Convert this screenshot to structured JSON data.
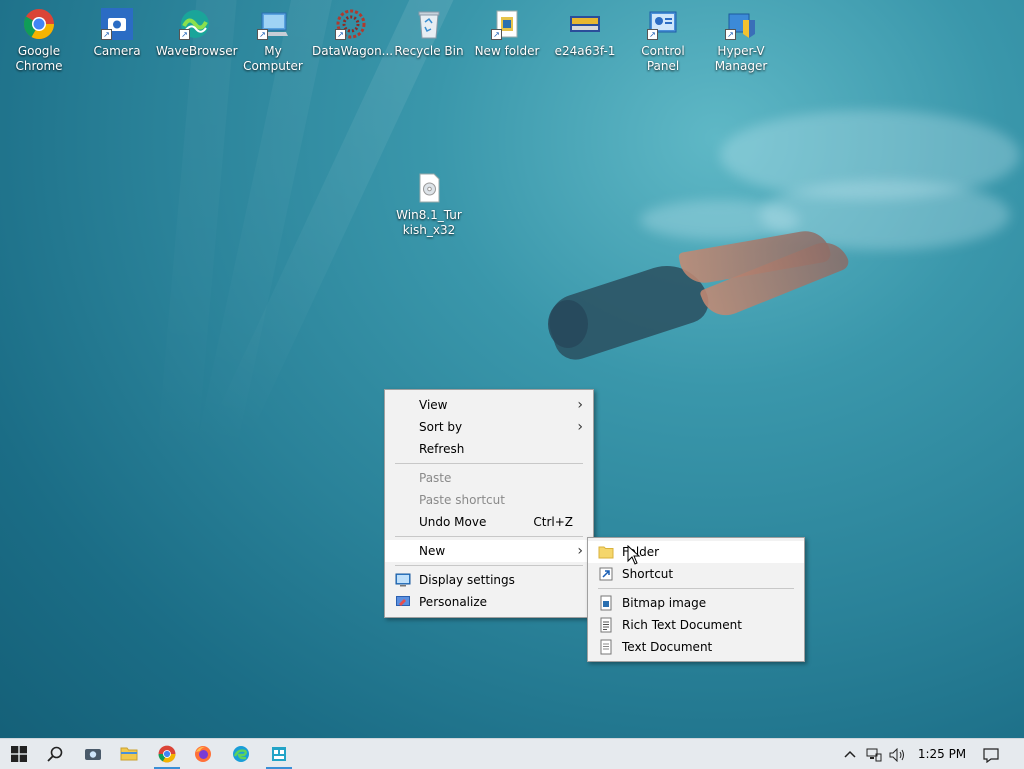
{
  "desktop": {
    "icons": [
      {
        "label": "Google Chrome",
        "icon": "chrome-icon"
      },
      {
        "label": "Camera",
        "icon": "camera-icon"
      },
      {
        "label": "WaveBrowser",
        "icon": "wavebrowser-icon"
      },
      {
        "label": "My Computer",
        "icon": "computer-icon"
      },
      {
        "label": "DataWagon...",
        "icon": "datawagon-icon"
      },
      {
        "label": "Recycle Bin",
        "icon": "recycle-bin-icon"
      },
      {
        "label": "New folder",
        "icon": "folder-icon"
      },
      {
        "label": "e24a63f-1",
        "icon": "image-file-icon"
      },
      {
        "label": "Control Panel",
        "icon": "control-panel-icon"
      },
      {
        "label": "Hyper-V Manager",
        "icon": "hyperv-icon"
      },
      {
        "label": "Win8.1_Turkish_x32",
        "icon": "disc-image-icon"
      }
    ]
  },
  "context_menu": {
    "view": "View",
    "sort_by": "Sort by",
    "refresh": "Refresh",
    "paste": "Paste",
    "paste_shortcut": "Paste shortcut",
    "undo_move": "Undo Move",
    "undo_shortcut": "Ctrl+Z",
    "new": "New",
    "display_settings": "Display settings",
    "personalize": "Personalize"
  },
  "submenu_new": {
    "folder": "Folder",
    "shortcut": "Shortcut",
    "bitmap": "Bitmap image",
    "rtf": "Rich Text Document",
    "text": "Text Document"
  },
  "taskbar": {
    "time": "1:25 PM"
  }
}
